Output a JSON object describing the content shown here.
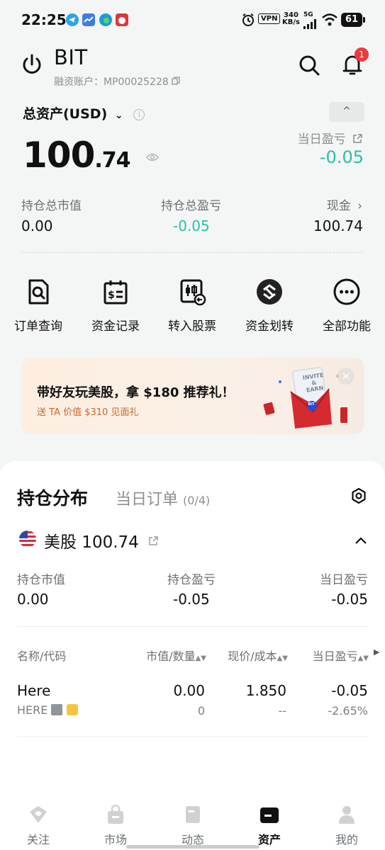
{
  "status_bar": {
    "time": "22:25",
    "vpn": "VPN",
    "net_speed_top": "340",
    "net_speed_bottom": "KB/s",
    "signal": "5G",
    "battery": "61"
  },
  "header": {
    "brand": "BIT",
    "account_label": "融资账户：MP00025228",
    "notification_count": "1"
  },
  "assets": {
    "total_label": "总资产(USD)",
    "total_int": "100",
    "total_dec": ".74",
    "collapse_symbol": "^",
    "day_pl_label": "当日盈亏",
    "day_pl_value": "-0.05"
  },
  "stats": [
    {
      "label": "持仓总市值",
      "value": "0.00"
    },
    {
      "label": "持仓总盈亏",
      "value": "-0.05"
    },
    {
      "label": "现金",
      "value": "100.74"
    }
  ],
  "functions": [
    {
      "label": "订单查询",
      "icon": "order-search-icon"
    },
    {
      "label": "资金记录",
      "icon": "fund-record-icon"
    },
    {
      "label": "转入股票",
      "icon": "transfer-stock-icon"
    },
    {
      "label": "资金划转",
      "icon": "fund-transfer-icon"
    },
    {
      "label": "全部功能",
      "icon": "more-icon"
    }
  ],
  "banner": {
    "title": "带好友玩美股，拿 $180 推荐礼！",
    "subtitle": "送 TA 价值 $310 见面礼",
    "card_text_1": "INVITE",
    "card_text_2": "&",
    "card_text_3": "EARN",
    "badge": "BIT"
  },
  "holdings": {
    "tab_active": "持仓分布",
    "tab_inactive": "当日订单",
    "tab_inactive_count": "(0/4)",
    "market_title": "美股 100.74",
    "summary": [
      {
        "label": "持仓市值",
        "value": "0.00"
      },
      {
        "label": "持仓盈亏",
        "value": "-0.05"
      },
      {
        "label": "当日盈亏",
        "value": "-0.05"
      }
    ],
    "columns": [
      "名称/代码",
      "市值/数量",
      "现价/成本",
      "当日盈亏"
    ],
    "rows": [
      {
        "name": "Here",
        "code": "HERE",
        "market_value": "0.00",
        "quantity": "0",
        "price": "1.850",
        "cost": "--",
        "day_pl": "-0.05",
        "day_pl_pct": "-2.65%"
      }
    ]
  },
  "nav": [
    {
      "label": "关注"
    },
    {
      "label": "市场"
    },
    {
      "label": "动态"
    },
    {
      "label": "资产"
    },
    {
      "label": "我的"
    }
  ],
  "colors": {
    "accent_green": "#2bbfa6",
    "badge_red": "#ea3b3b",
    "banner_orange": "#c8682a"
  }
}
